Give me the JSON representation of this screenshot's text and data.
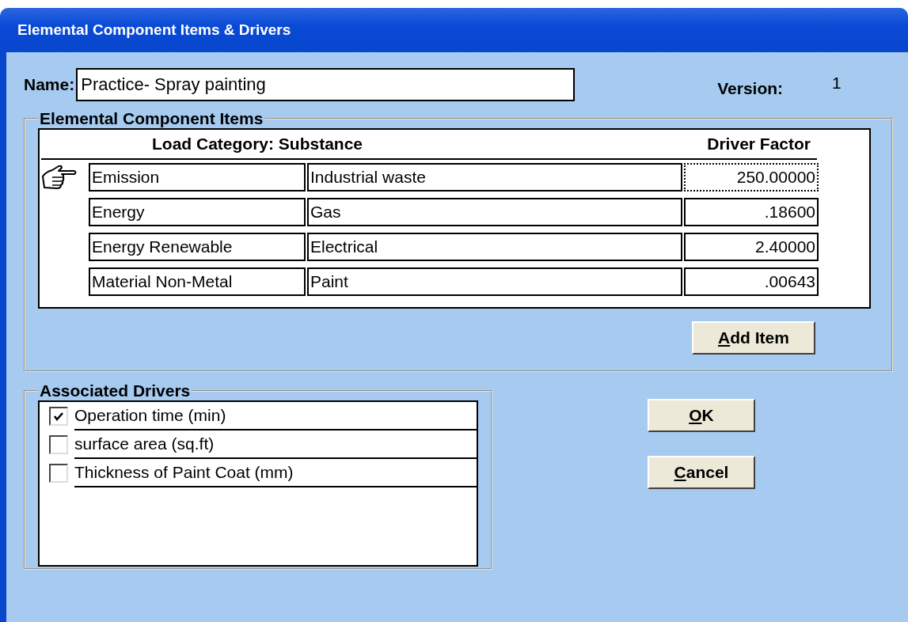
{
  "window": {
    "title": "Elemental Component Items & Drivers"
  },
  "name_field": {
    "label": "Name:",
    "value": "Practice- Spray painting"
  },
  "version": {
    "label": "Version:",
    "value": "1"
  },
  "items_group": {
    "title": "Elemental Component Items",
    "columns": [
      "Load Category: Substance",
      "Driver Factor"
    ],
    "rows": [
      {
        "category": "Emission",
        "substance": "Industrial waste",
        "factor": "250.00000",
        "selected": true
      },
      {
        "category": "Energy",
        "substance": "Gas",
        "factor": ".18600",
        "selected": false
      },
      {
        "category": "Energy Renewable",
        "substance": "Electrical",
        "factor": "2.40000",
        "selected": false
      },
      {
        "category": "Material Non-Metal",
        "substance": "Paint",
        "factor": ".00643",
        "selected": false
      }
    ],
    "add_button": {
      "label": "Add Item",
      "first_letter_underlined": true
    }
  },
  "drivers_group": {
    "title": "Associated Drivers",
    "drivers": [
      {
        "label": "Operation time (min)",
        "checked": true
      },
      {
        "label": "surface area (sq.ft)",
        "checked": false
      },
      {
        "label": "Thickness of Paint Coat (mm)",
        "checked": false
      }
    ]
  },
  "buttons": [
    {
      "label": "OK",
      "first_letter_underlined": true
    },
    {
      "label": "Cancel",
      "first_letter_underlined": true
    }
  ]
}
